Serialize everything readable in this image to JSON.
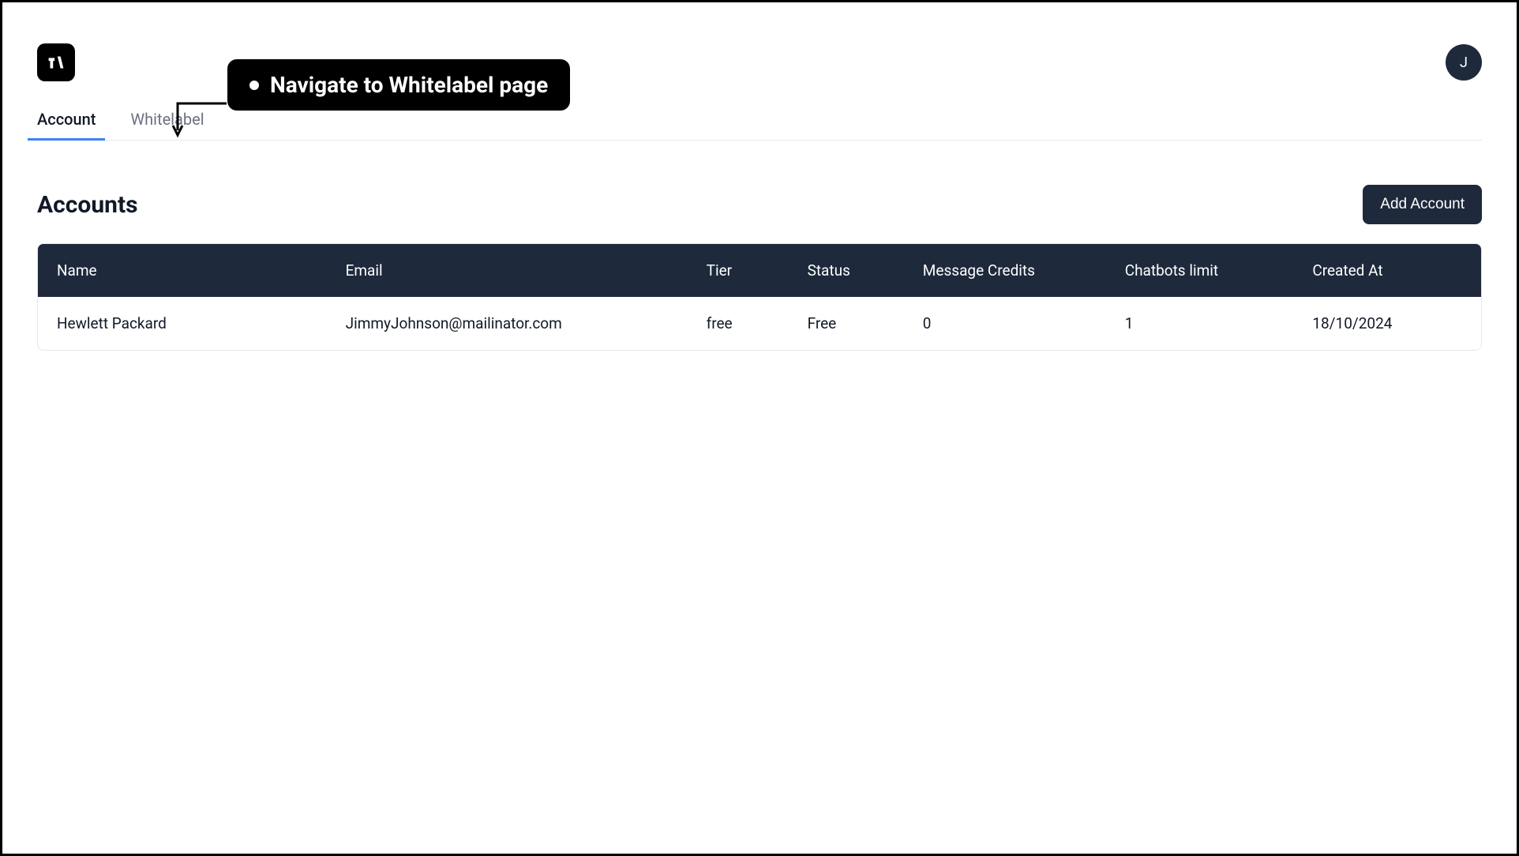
{
  "header": {
    "avatar_initial": "J"
  },
  "tabs": [
    {
      "label": "Account",
      "active": true
    },
    {
      "label": "Whitelabel",
      "active": false
    }
  ],
  "page_title": "Accounts",
  "add_button": "Add Account",
  "table": {
    "columns": [
      "Name",
      "Email",
      "Tier",
      "Status",
      "Message Credits",
      "Chatbots limit",
      "Created At"
    ],
    "rows": [
      {
        "name": "Hewlett Packard",
        "email": "JimmyJohnson@mailinator.com",
        "tier": "free",
        "status": "Free",
        "credits": "0",
        "limit": "1",
        "created": "18/10/2024"
      }
    ]
  },
  "callout": {
    "text": "Navigate to Whitelabel page"
  }
}
